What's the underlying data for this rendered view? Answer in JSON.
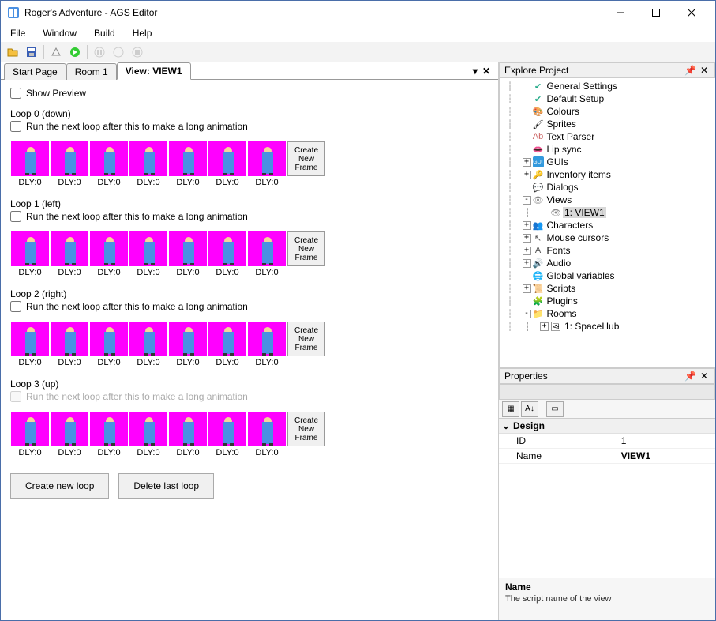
{
  "window": {
    "title": "Roger's Adventure - AGS Editor"
  },
  "menubar": {
    "file": "File",
    "window": "Window",
    "build": "Build",
    "help": "Help"
  },
  "tabs": {
    "items": [
      {
        "label": "Start Page"
      },
      {
        "label": "Room 1"
      },
      {
        "label": "View: VIEW1"
      }
    ],
    "active_index": 2
  },
  "view_editor": {
    "show_preview_label": "Show Preview",
    "run_next_loop_label": "Run the next loop after this to make a long animation",
    "create_frame_label": "Create New Frame",
    "create_loop_label": "Create new loop",
    "delete_loop_label": "Delete last loop",
    "loops": [
      {
        "title": "Loop 0 (down)",
        "enabled": true,
        "frames": [
          "DLY:0",
          "DLY:0",
          "DLY:0",
          "DLY:0",
          "DLY:0",
          "DLY:0",
          "DLY:0"
        ]
      },
      {
        "title": "Loop 1 (left)",
        "enabled": true,
        "frames": [
          "DLY:0",
          "DLY:0",
          "DLY:0",
          "DLY:0",
          "DLY:0",
          "DLY:0",
          "DLY:0"
        ]
      },
      {
        "title": "Loop 2 (right)",
        "enabled": true,
        "frames": [
          "DLY:0",
          "DLY:0",
          "DLY:0",
          "DLY:0",
          "DLY:0",
          "DLY:0",
          "DLY:0"
        ]
      },
      {
        "title": "Loop 3 (up)",
        "enabled": false,
        "frames": [
          "DLY:0",
          "DLY:0",
          "DLY:0",
          "DLY:0",
          "DLY:0",
          "DLY:0",
          "DLY:0"
        ]
      }
    ]
  },
  "explore": {
    "title": "Explore Project",
    "items": [
      {
        "indent": 1,
        "expander": null,
        "icon": "✔",
        "icon_color": "#2a8",
        "label": "General Settings"
      },
      {
        "indent": 1,
        "expander": null,
        "icon": "✔",
        "icon_color": "#2a8",
        "label": "Default Setup"
      },
      {
        "indent": 1,
        "expander": null,
        "icon": "🎨",
        "icon_color": "",
        "label": "Colours"
      },
      {
        "indent": 1,
        "expander": null,
        "icon": "🖌",
        "icon_color": "",
        "label": "Sprites"
      },
      {
        "indent": 1,
        "expander": null,
        "icon": "Ab",
        "icon_color": "#c66",
        "label": "Text Parser"
      },
      {
        "indent": 1,
        "expander": null,
        "icon": "👄",
        "icon_color": "",
        "label": "Lip sync"
      },
      {
        "indent": 1,
        "expander": "+",
        "icon": "GUI",
        "icon_color": "#39d",
        "label": "GUIs"
      },
      {
        "indent": 1,
        "expander": "+",
        "icon": "🔑",
        "icon_color": "",
        "label": "Inventory items"
      },
      {
        "indent": 1,
        "expander": null,
        "icon": "💬",
        "icon_color": "",
        "label": "Dialogs"
      },
      {
        "indent": 1,
        "expander": "-",
        "icon": "👁",
        "icon_color": "#888",
        "label": "Views"
      },
      {
        "indent": 2,
        "expander": null,
        "icon": "👁",
        "icon_color": "#888",
        "label": "1: VIEW1",
        "selected": true
      },
      {
        "indent": 1,
        "expander": "+",
        "icon": "👥",
        "icon_color": "",
        "label": "Characters"
      },
      {
        "indent": 1,
        "expander": "+",
        "icon": "↖",
        "icon_color": "#555",
        "label": "Mouse cursors"
      },
      {
        "indent": 1,
        "expander": "+",
        "icon": "A",
        "icon_color": "#555",
        "label": "Fonts"
      },
      {
        "indent": 1,
        "expander": "+",
        "icon": "🔊",
        "icon_color": "",
        "label": "Audio"
      },
      {
        "indent": 1,
        "expander": null,
        "icon": "🌐",
        "icon_color": "",
        "label": "Global variables"
      },
      {
        "indent": 1,
        "expander": "+",
        "icon": "📜",
        "icon_color": "",
        "label": "Scripts"
      },
      {
        "indent": 1,
        "expander": null,
        "icon": "🧩",
        "icon_color": "",
        "label": "Plugins"
      },
      {
        "indent": 1,
        "expander": "-",
        "icon": "📁",
        "icon_color": "#c90",
        "label": "Rooms"
      },
      {
        "indent": 2,
        "expander": "+",
        "icon": "🖼",
        "icon_color": "",
        "label": "1: SpaceHub"
      }
    ]
  },
  "properties": {
    "title": "Properties",
    "category": "Design",
    "rows": [
      {
        "name": "ID",
        "value": "1",
        "bold": false
      },
      {
        "name": "Name",
        "value": "VIEW1",
        "bold": true
      }
    ],
    "desc_title": "Name",
    "desc_text": "The script name of the view"
  }
}
